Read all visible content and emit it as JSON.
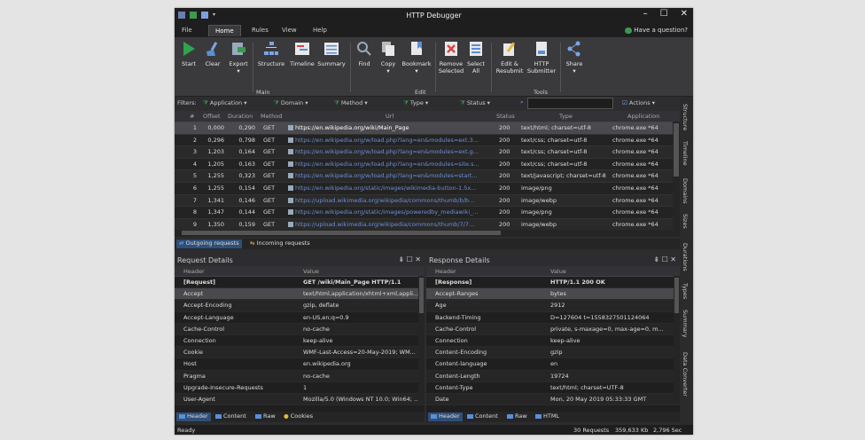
{
  "window": {
    "title": "HTTP Debugger",
    "minimize": "–",
    "maximize": "☐",
    "close": "✕"
  },
  "menu": {
    "items": [
      "File",
      "Home",
      "Rules",
      "View",
      "Help"
    ],
    "help_link": "Have a question?"
  },
  "ribbon": {
    "buttons": [
      {
        "label": "Start"
      },
      {
        "label": "Clear"
      },
      {
        "label": "Export"
      },
      {
        "label": "Structure"
      },
      {
        "label": "Timeline"
      },
      {
        "label": "Summary"
      },
      {
        "label": "Find"
      },
      {
        "label": "Copy"
      },
      {
        "label": "Bookmark"
      },
      {
        "label": "Remove\nSelected"
      },
      {
        "label": "Select\nAll"
      },
      {
        "label": "Edit &\nResubmit"
      },
      {
        "label": "HTTP\nSubmitter"
      },
      {
        "label": "Share"
      }
    ],
    "groups": [
      "Main",
      "Edit",
      "Tools"
    ]
  },
  "filters": {
    "label": "Filters:",
    "items": [
      "Application",
      "Domain",
      "Method",
      "Type",
      "Status"
    ],
    "actions": "Actions"
  },
  "side_tabs": [
    "Structure",
    "Timeline",
    "Domains",
    "Sizes",
    "Durations",
    "Types",
    "Summary",
    "Data Converter"
  ],
  "table": {
    "columns": [
      "#",
      "Offset",
      "Duration",
      "Method",
      "Url",
      "Status",
      "Type",
      "Application"
    ],
    "rows": [
      [
        "1",
        "0,000",
        "0,290",
        "GET",
        "https://en.wikipedia.org/wiki/Main_Page",
        "200",
        "text/html; charset=utf-8",
        "chrome.exe *64"
      ],
      [
        "2",
        "0,296",
        "0,798",
        "GET",
        "https://en.wikipedia.org/w/load.php?lang=en&modules=ext.3...",
        "200",
        "text/css; charset=utf-8",
        "chrome.exe *64"
      ],
      [
        "3",
        "1,203",
        "0,164",
        "GET",
        "https://en.wikipedia.org/w/load.php?lang=en&modules=ext.g...",
        "200",
        "text/css; charset=utf-8",
        "chrome.exe *64"
      ],
      [
        "4",
        "1,205",
        "0,163",
        "GET",
        "https://en.wikipedia.org/w/load.php?lang=en&modules=site.s...",
        "200",
        "text/css; charset=utf-8",
        "chrome.exe *64"
      ],
      [
        "5",
        "1,255",
        "0,323",
        "GET",
        "https://en.wikipedia.org/w/load.php?lang=en&modules=start...",
        "200",
        "text/javascript; charset=utf-8",
        "chrome.exe *64"
      ],
      [
        "6",
        "1,255",
        "0,154",
        "GET",
        "https://en.wikipedia.org/static/images/wikimedia-button-1.5x...",
        "200",
        "image/png",
        "chrome.exe *64"
      ],
      [
        "7",
        "1,341",
        "0,146",
        "GET",
        "https://upload.wikimedia.org/wikipedia/commons/thumb/b/b...",
        "200",
        "image/webp",
        "chrome.exe *64"
      ],
      [
        "8",
        "1,347",
        "0,144",
        "GET",
        "https://en.wikipedia.org/static/images/poweredby_mediawiki_...",
        "200",
        "image/png",
        "chrome.exe *64"
      ],
      [
        "9",
        "1,350",
        "0,159",
        "GET",
        "https://upload.wikimedia.org/wikipedia/commons/thumb/7/7...",
        "200",
        "image/webp",
        "chrome.exe *64"
      ]
    ]
  },
  "request_tabs": [
    "Outgoing requests",
    "Incoming requests"
  ],
  "request_details": {
    "title": "Request Details",
    "header_col": "Header",
    "value_col": "Value",
    "rows": [
      [
        "[Request]",
        "GET /wiki/Main_Page HTTP/1.1"
      ],
      [
        "Accept",
        "text/html,application/xhtml+xml,appli..."
      ],
      [
        "Accept-Encoding",
        "gzip, deflate"
      ],
      [
        "Accept-Language",
        "en-US,en;q=0.9"
      ],
      [
        "Cache-Control",
        "no-cache"
      ],
      [
        "Connection",
        "keep-alive"
      ],
      [
        "Cookie",
        "WMF-Last-Access=20-May-2019; WM..."
      ],
      [
        "Host",
        "en.wikipedia.org"
      ],
      [
        "Pragma",
        "no-cache"
      ],
      [
        "Upgrade-Insecure-Requests",
        "1"
      ],
      [
        "User-Agent",
        "Mozilla/5.0 (Windows NT 10.0; Win64; ..."
      ]
    ],
    "tabs": [
      "Header",
      "Content",
      "Raw",
      "Cookies"
    ]
  },
  "response_details": {
    "title": "Response Details",
    "header_col": "Header",
    "value_col": "Value",
    "rows": [
      [
        "[Response]",
        "HTTP/1.1 200 OK"
      ],
      [
        "Accept-Ranges",
        "bytes"
      ],
      [
        "Age",
        "2912"
      ],
      [
        "Backend-Timing",
        "D=127604 t=1558327501124064"
      ],
      [
        "Cache-Control",
        "private, s-maxage=0, max-age=0, m..."
      ],
      [
        "Connection",
        "keep-alive"
      ],
      [
        "Content-Encoding",
        "gzip"
      ],
      [
        "Content-language",
        "en"
      ],
      [
        "Content-Length",
        "19724"
      ],
      [
        "Content-Type",
        "text/html; charset=UTF-8"
      ],
      [
        "Date",
        "Mon, 20 May 2019 05:33:33 GMT"
      ]
    ],
    "tabs": [
      "Header",
      "Content",
      "Raw",
      "HTML"
    ]
  },
  "pane_controls": "⇟ ☐ ✕",
  "status": {
    "left": "Ready",
    "requests": "30 Requests",
    "size": "359,633 Kb",
    "time": "2,796 Sec"
  },
  "colors": {
    "accent": "#2f4f78",
    "url": "#6b8fd6",
    "start_green": "#2ea44f"
  }
}
